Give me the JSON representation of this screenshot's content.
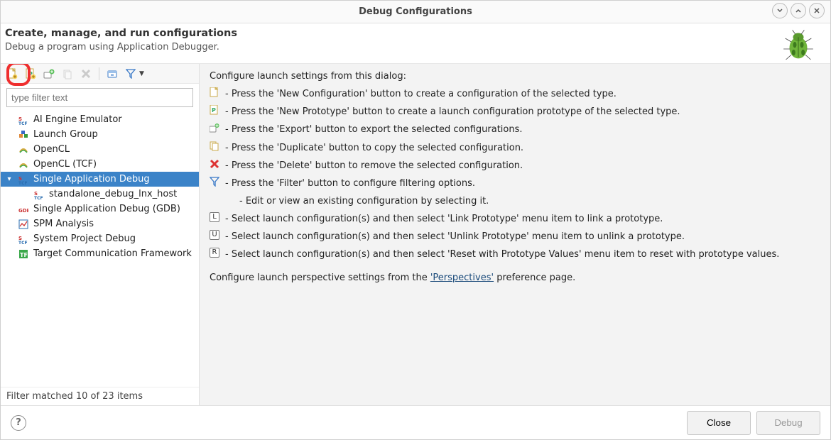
{
  "titlebar": {
    "title": "Debug Configurations"
  },
  "header": {
    "title": "Create, manage, and run configurations",
    "subtitle": "Debug a program using Application Debugger."
  },
  "filter": {
    "placeholder": "type filter text"
  },
  "tree": {
    "items": [
      {
        "label": "AI Engine Emulator"
      },
      {
        "label": "Launch Group"
      },
      {
        "label": "OpenCL"
      },
      {
        "label": "OpenCL (TCF)"
      },
      {
        "label": "Single Application Debug",
        "selected": true,
        "expanded": true,
        "children": [
          {
            "label": "standalone_debug_lnx_host"
          }
        ]
      },
      {
        "label": "Single Application Debug (GDB)"
      },
      {
        "label": "SPM Analysis"
      },
      {
        "label": "System Project Debug"
      },
      {
        "label": "Target Communication Framework"
      }
    ]
  },
  "matched_label": "Filter matched 10 of 23 items",
  "info": {
    "intro": "Configure launch settings from this dialog:",
    "rows": [
      {
        "icon": "new-doc",
        "text": " - Press the 'New Configuration' button to create a configuration of the selected type."
      },
      {
        "icon": "new-proto",
        "text": " - Press the 'New Prototype' button to create a launch configuration prototype of the selected type."
      },
      {
        "icon": "export",
        "text": " - Press the 'Export' button to export the selected configurations."
      },
      {
        "icon": "duplicate",
        "text": " - Press the 'Duplicate' button to copy the selected configuration."
      },
      {
        "icon": "delete",
        "text": " - Press the 'Delete' button to remove the selected configuration."
      },
      {
        "icon": "filter",
        "text": " - Press the 'Filter' button to configure filtering options."
      },
      {
        "icon": "none",
        "text": "   - Edit or view an existing configuration by selecting it."
      },
      {
        "icon": "key-L",
        "text": " - Select launch configuration(s) and then select 'Link Prototype' menu item to link a prototype."
      },
      {
        "icon": "key-U",
        "text": " - Select launch configuration(s) and then select 'Unlink Prototype' menu item to unlink a prototype."
      },
      {
        "icon": "key-R",
        "text": " - Select launch configuration(s) and then select 'Reset with Prototype Values' menu item to reset with prototype values."
      }
    ],
    "outro_a": "Configure launch perspective settings from the ",
    "outro_link": "'Perspectives'",
    "outro_b": " preference page."
  },
  "footer": {
    "close": "Close",
    "debug": "Debug"
  }
}
